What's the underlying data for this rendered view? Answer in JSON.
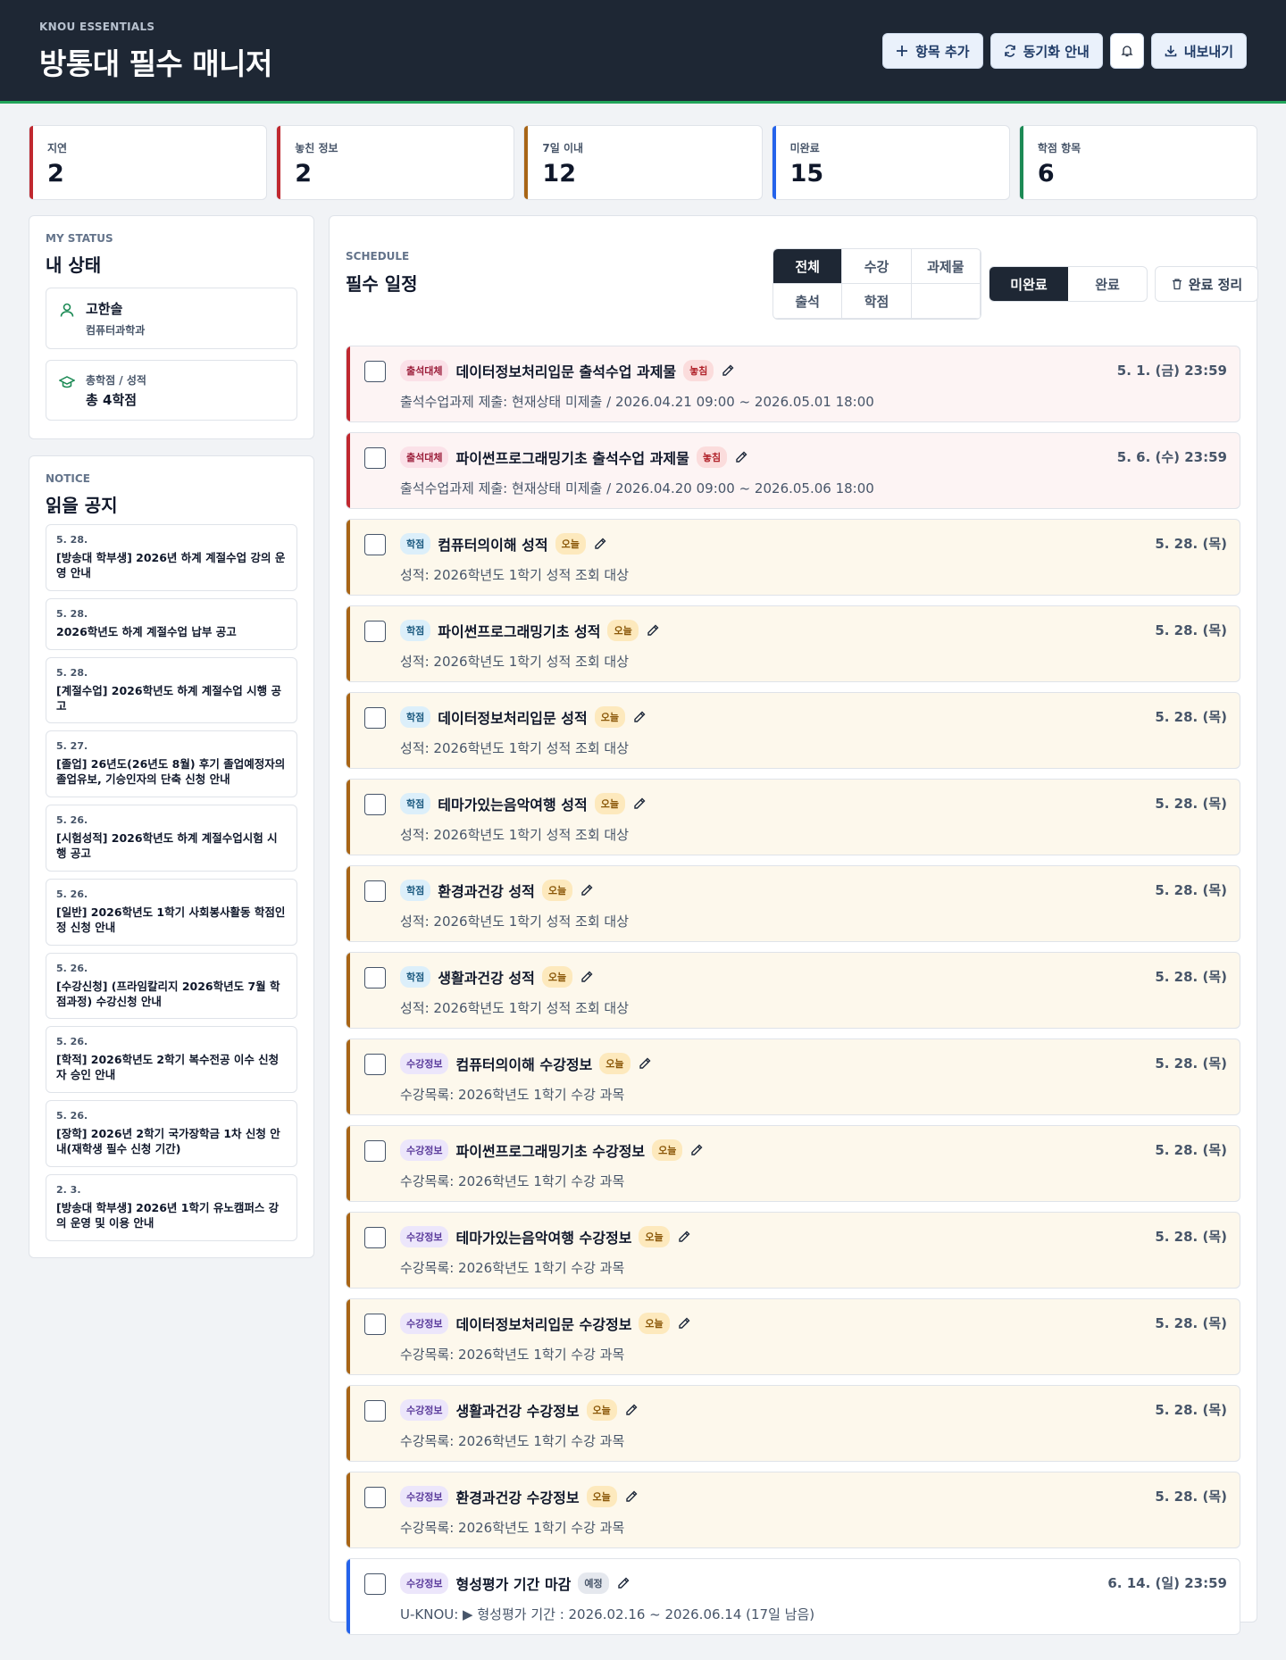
{
  "header": {
    "kicker": "KNOU ESSENTIALS",
    "title": "방통대 필수 매니저"
  },
  "actions": {
    "add": "항목 추가",
    "sync": "동기화 안내",
    "export": "내보내기"
  },
  "stats": [
    {
      "label": "지연",
      "value": "2",
      "color": "#c0282f"
    },
    {
      "label": "놓친 정보",
      "value": "2",
      "color": "#c0282f"
    },
    {
      "label": "7일 이내",
      "value": "12",
      "color": "#a86516"
    },
    {
      "label": "미완료",
      "value": "15",
      "color": "#2563eb"
    },
    {
      "label": "학점 항목",
      "value": "6",
      "color": "#1c8a55"
    }
  ],
  "status": {
    "kicker": "MY STATUS",
    "title": "내 상태",
    "name": "고한솔",
    "dept": "컴퓨터과학과",
    "credit_label": "총학점 / 성적",
    "credit_value": "총 4학점"
  },
  "notices_section": {
    "kicker": "NOTICE",
    "title": "읽을 공지"
  },
  "notices": [
    {
      "date": "5. 28.",
      "title": "[방송대 학부생] 2026년 하계 계절수업 강의 운영 안내"
    },
    {
      "date": "5. 28.",
      "title": "2026학년도 하계 계절수업 납부 공고"
    },
    {
      "date": "5. 28.",
      "title": "[계절수업] 2026학년도 하계 계절수업 시행 공고"
    },
    {
      "date": "5. 27.",
      "title": "[졸업] 26년도(26년도 8월) 후기 졸업예정자의 졸업유보, 기승인자의 단축 신청 안내"
    },
    {
      "date": "5. 26.",
      "title": "[시험성적] 2026학년도 하계 계절수업시험 시행 공고"
    },
    {
      "date": "5. 26.",
      "title": "[일반] 2026학년도 1학기 사회봉사활동 학점인정 신청 안내"
    },
    {
      "date": "5. 26.",
      "title": "[수강신청] (프라임칼리지 2026학년도 7월 학점과정) 수강신청 안내"
    },
    {
      "date": "5. 26.",
      "title": "[학적] 2026학년도 2학기 복수전공 이수 신청자 승인 안내"
    },
    {
      "date": "5. 26.",
      "title": "[장학] 2026년 2학기 국가장학금 1차 신청 안내(재학생 필수 신청 기간)"
    },
    {
      "date": "2. 3.",
      "title": "[방송대 학부생] 2026년 1학기 유노캠퍼스 강의 운영 및 이용 안내"
    }
  ],
  "schedule": {
    "kicker": "SCHEDULE",
    "title": "필수 일정",
    "filters": [
      "전체",
      "수강",
      "과제물",
      "출석",
      "학점",
      ""
    ],
    "active_filter": 0,
    "segments": [
      "미완료",
      "완료"
    ],
    "cleanup": "완료 정리"
  },
  "items": [
    {
      "tone": "red",
      "tag": "출석대체",
      "tag_type": "att",
      "title": "데이터정보처리입문 출석수업 과제물",
      "badge": "놓침",
      "badge_type": "missed",
      "desc": "출석수업과제 제출: 현재상태 미제출 / 2026.04.21 09:00 ~ 2026.05.01 18:00",
      "date": "5. 1. (금) 23:59"
    },
    {
      "tone": "red",
      "tag": "출석대체",
      "tag_type": "att",
      "title": "파이썬프로그래밍기초 출석수업 과제물",
      "badge": "놓침",
      "badge_type": "missed",
      "desc": "출석수업과제 제출: 현재상태 미제출 / 2026.04.20 09:00 ~ 2026.05.06 18:00",
      "date": "5. 6. (수) 23:59"
    },
    {
      "tone": "amber",
      "tag": "학점",
      "tag_type": "grade",
      "title": "컴퓨터의이해 성적",
      "badge": "오늘",
      "badge_type": "today",
      "desc": "성적: 2026학년도 1학기 성적 조회 대상",
      "date": "5. 28. (목)"
    },
    {
      "tone": "amber",
      "tag": "학점",
      "tag_type": "grade",
      "title": "파이썬프로그래밍기초 성적",
      "badge": "오늘",
      "badge_type": "today",
      "desc": "성적: 2026학년도 1학기 성적 조회 대상",
      "date": "5. 28. (목)"
    },
    {
      "tone": "amber",
      "tag": "학점",
      "tag_type": "grade",
      "title": "데이터정보처리입문 성적",
      "badge": "오늘",
      "badge_type": "today",
      "desc": "성적: 2026학년도 1학기 성적 조회 대상",
      "date": "5. 28. (목)"
    },
    {
      "tone": "amber",
      "tag": "학점",
      "tag_type": "grade",
      "title": "테마가있는음악여행 성적",
      "badge": "오늘",
      "badge_type": "today",
      "desc": "성적: 2026학년도 1학기 성적 조회 대상",
      "date": "5. 28. (목)"
    },
    {
      "tone": "amber",
      "tag": "학점",
      "tag_type": "grade",
      "title": "환경과건강 성적",
      "badge": "오늘",
      "badge_type": "today",
      "desc": "성적: 2026학년도 1학기 성적 조회 대상",
      "date": "5. 28. (목)"
    },
    {
      "tone": "amber",
      "tag": "학점",
      "tag_type": "grade",
      "title": "생활과건강 성적",
      "badge": "오늘",
      "badge_type": "today",
      "desc": "성적: 2026학년도 1학기 성적 조회 대상",
      "date": "5. 28. (목)"
    },
    {
      "tone": "amber",
      "tag": "수강정보",
      "tag_type": "info",
      "title": "컴퓨터의이해 수강정보",
      "badge": "오늘",
      "badge_type": "today",
      "desc": "수강목록: 2026학년도 1학기 수강 과목",
      "date": "5. 28. (목)"
    },
    {
      "tone": "amber",
      "tag": "수강정보",
      "tag_type": "info",
      "title": "파이썬프로그래밍기초 수강정보",
      "badge": "오늘",
      "badge_type": "today",
      "desc": "수강목록: 2026학년도 1학기 수강 과목",
      "date": "5. 28. (목)"
    },
    {
      "tone": "amber",
      "tag": "수강정보",
      "tag_type": "info",
      "title": "테마가있는음악여행 수강정보",
      "badge": "오늘",
      "badge_type": "today",
      "desc": "수강목록: 2026학년도 1학기 수강 과목",
      "date": "5. 28. (목)"
    },
    {
      "tone": "amber",
      "tag": "수강정보",
      "tag_type": "info",
      "title": "데이터정보처리입문 수강정보",
      "badge": "오늘",
      "badge_type": "today",
      "desc": "수강목록: 2026학년도 1학기 수강 과목",
      "date": "5. 28. (목)"
    },
    {
      "tone": "amber",
      "tag": "수강정보",
      "tag_type": "info",
      "title": "생활과건강 수강정보",
      "badge": "오늘",
      "badge_type": "today",
      "desc": "수강목록: 2026학년도 1학기 수강 과목",
      "date": "5. 28. (목)"
    },
    {
      "tone": "amber",
      "tag": "수강정보",
      "tag_type": "info",
      "title": "환경과건강 수강정보",
      "badge": "오늘",
      "badge_type": "today",
      "desc": "수강목록: 2026학년도 1학기 수강 과목",
      "date": "5. 28. (목)"
    },
    {
      "tone": "blue",
      "tag": "수강정보",
      "tag_type": "info",
      "title": "형성평가 기간 마감",
      "badge": "예정",
      "badge_type": "planned",
      "desc": "U-KNOU: ▶ 형성평가 기간 : 2026.02.16 ~ 2026.06.14 (17일 남음)",
      "date": "6. 14. (일) 23:59"
    }
  ]
}
